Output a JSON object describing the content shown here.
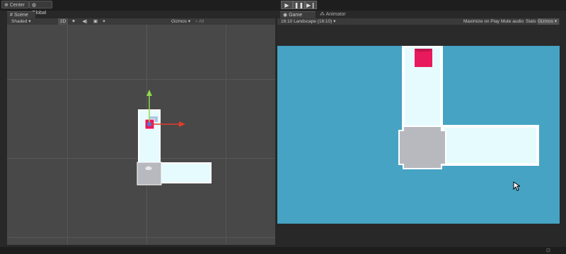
{
  "toolbar": {
    "pivot_label": "Center",
    "space_label": "Global",
    "play_icon": "play-icon",
    "pause_icon": "pause-icon",
    "step_icon": "step-icon"
  },
  "scene": {
    "tab_label": "Scene",
    "shading_label": "Shaded",
    "mode_2d_label": "2D",
    "gizmos_label": "Gizmos ▾",
    "search_placeholder": "All"
  },
  "game": {
    "tabs": [
      "Game",
      "Animator"
    ],
    "aspect_label": "16:10 Landscape (16:10)",
    "maximize_label": "Maximize on Play",
    "mute_label": "Mute audio",
    "stats_label": "Stats",
    "gizmos_label": "Gizmos ▾"
  },
  "colors": {
    "game_background": "#46a3c4",
    "path_fill": "#e6fbfd",
    "path_border": "#ffffff",
    "player": "#e8195c",
    "junction": "#b7b9bf",
    "gizmo_x": "#e03c2c",
    "gizmo_y": "#8fd94a"
  }
}
